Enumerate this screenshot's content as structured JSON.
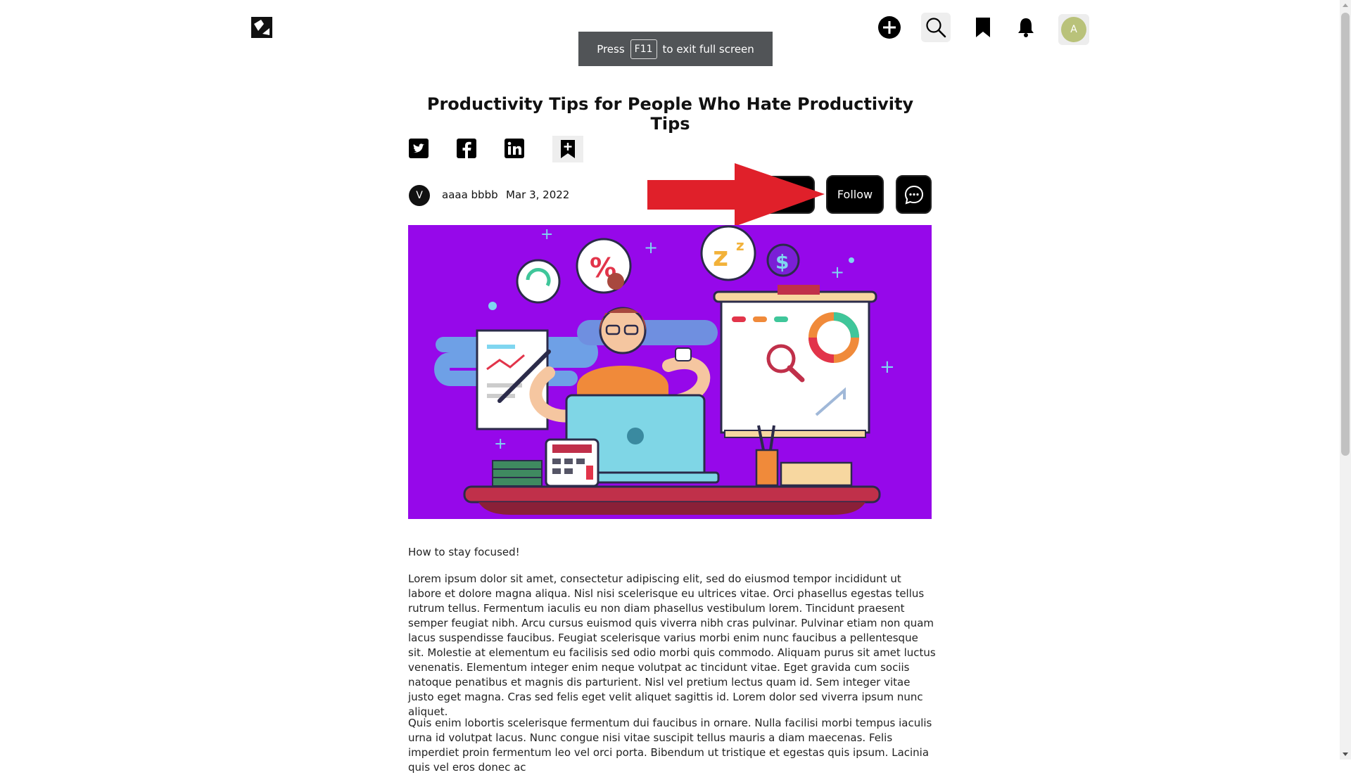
{
  "nav": {
    "logo": "site-logo",
    "icons": [
      "add-icon",
      "search-icon",
      "bookmark-icon",
      "bell-icon"
    ],
    "avatar_initial": "A"
  },
  "fullscreen_toast": {
    "prefix": "Press",
    "key": "F11",
    "suffix": "to exit full screen"
  },
  "article": {
    "title": "Productivity Tips for People Who Hate Productivity Tips",
    "share_icons": [
      "twitter-icon",
      "facebook-icon",
      "linkedin-icon",
      "bookmark-add-icon"
    ],
    "author": {
      "initial": "V",
      "name": "aaaa bbbb",
      "date": "Mar 3, 2022"
    },
    "follow_label": "Follow",
    "lead": "How to stay focused!",
    "paragraphs": [
      "Lorem ipsum dolor sit amet, consectetur adipiscing elit, sed do eiusmod tempor incididunt ut labore et dolore magna aliqua. Nisl nisi scelerisque eu ultrices vitae. Orci phasellus egestas tellus rutrum tellus. Fermentum iaculis eu non diam phasellus vestibulum lorem. Tincidunt praesent semper feugiat nibh. Arcu cursus euismod quis viverra nibh cras pulvinar. Pulvinar etiam non quam lacus suspendisse faucibus. Feugiat scelerisque varius morbi enim nunc faucibus a pellentesque sit. Molestie at elementum eu facilisis sed odio morbi quis commodo. Aliquam purus sit amet luctus venenatis. Elementum integer enim neque volutpat ac tincidunt vitae. Eget gravida cum sociis natoque penatibus et magnis dis parturient. Nisl vel pretium lectus quam id. Sem integer vitae justo eget magna. Cras sed felis eget velit aliquet sagittis id. Lorem dolor sed viverra ipsum nunc aliquet.",
      "Quis enim lobortis scelerisque fermentum dui faucibus in ornare. Nulla facilisi morbi tempus iaculis urna id volutpat lacus. Nunc congue nisi vitae suscipit tellus mauris a diam maecenas. Felis imperdiet proin fermentum leo vel orci porta. Bibendum ut tristique et egestas quis ipsum. Lacinia quis vel eros donec ac"
    ]
  },
  "colors": {
    "hero_background": "#9608ea",
    "annotation_arrow": "#e0202a",
    "button": "#000000"
  }
}
